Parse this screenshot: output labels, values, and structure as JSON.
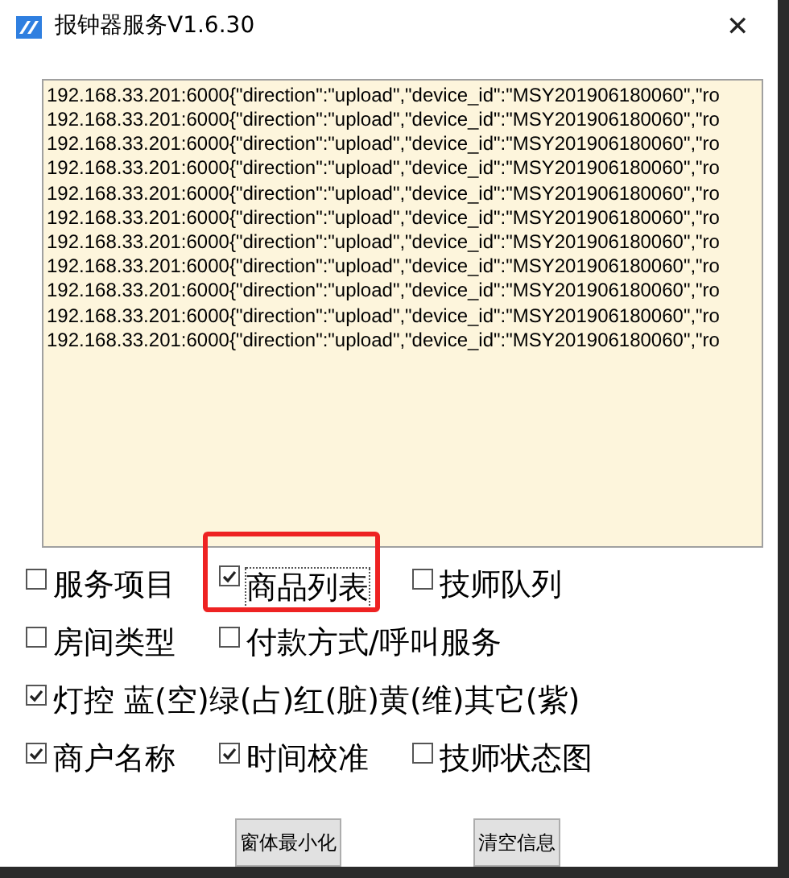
{
  "window": {
    "title": "报钟器服务V1.6.30",
    "close": "✕"
  },
  "log": {
    "lines": [
      "192.168.33.201:6000{\"direction\":\"upload\",\"device_id\":\"MSY201906180060\",\"ro",
      "192.168.33.201:6000{\"direction\":\"upload\",\"device_id\":\"MSY201906180060\",\"ro",
      "192.168.33.201:6000{\"direction\":\"upload\",\"device_id\":\"MSY201906180060\",\"ro",
      "192.168.33.201:6000{\"direction\":\"upload\",\"device_id\":\"MSY201906180060\",\"ro",
      "192.168.33.201:6000{\"direction\":\"upload\",\"device_id\":\"MSY201906180060\",\"ro",
      "192.168.33.201:6000{\"direction\":\"upload\",\"device_id\":\"MSY201906180060\",\"ro",
      "192.168.33.201:6000{\"direction\":\"upload\",\"device_id\":\"MSY201906180060\",\"ro",
      "192.168.33.201:6000{\"direction\":\"upload\",\"device_id\":\"MSY201906180060\",\"ro",
      "192.168.33.201:6000{\"direction\":\"upload\",\"device_id\":\"MSY201906180060\",\"ro",
      "192.168.33.201:6000{\"direction\":\"upload\",\"device_id\":\"MSY201906180060\",\"ro",
      "192.168.33.201:6000{\"direction\":\"upload\",\"device_id\":\"MSY201906180060\",\"ro"
    ]
  },
  "option_rows": [
    [
      {
        "label": "服务项目",
        "checked": false,
        "focused": false,
        "highlighted": false
      },
      {
        "label": "商品列表",
        "checked": true,
        "focused": true,
        "highlighted": true
      },
      {
        "label": "技师队列",
        "checked": false,
        "focused": false,
        "highlighted": false
      }
    ],
    [
      {
        "label": "房间类型",
        "checked": false,
        "focused": false,
        "highlighted": false
      },
      {
        "label": "付款方式/呼叫服务",
        "checked": false,
        "focused": false,
        "highlighted": false
      }
    ],
    [
      {
        "label": "灯控 蓝(空)绿(占)红(脏)黄(维)其它(紫)",
        "checked": true,
        "focused": false,
        "highlighted": false
      }
    ],
    [
      {
        "label": "商户名称",
        "checked": true,
        "focused": false,
        "highlighted": false
      },
      {
        "label": "时间校准",
        "checked": true,
        "focused": false,
        "highlighted": false
      },
      {
        "label": "技师状态图",
        "checked": false,
        "focused": false,
        "highlighted": false
      }
    ]
  ],
  "buttons": [
    "窗体最小化",
    "清空信息"
  ]
}
